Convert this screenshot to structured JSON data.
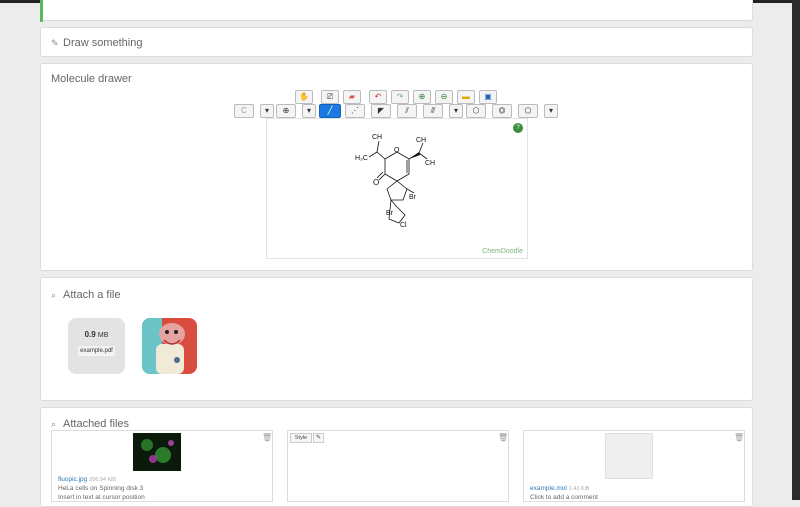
{
  "draw_section": {
    "title": "Draw something"
  },
  "molecule_section": {
    "title": "Molecule drawer",
    "toolbar_row1": [
      "hand-icon",
      "clear-icon",
      "eraser-icon",
      "undo-icon",
      "redo-icon",
      "zoom-in-icon",
      "zoom-out-icon",
      "open-icon",
      "save-icon"
    ],
    "element_label": "C",
    "canvas_badge": "?",
    "watermark": "ChemDoodle",
    "atom_labels": {
      "o": "O",
      "ch3_a": "CH",
      "ch3_b": "CH",
      "ch3_c": "CH",
      "h3c": "H₃C",
      "br1": "Br",
      "br2": "Br",
      "cl": "Cl"
    }
  },
  "attach_section": {
    "title": "Attach a file",
    "pdf_size_value": "0.9",
    "pdf_size_unit": "MB",
    "pdf_name": "example.pdf"
  },
  "attached_files": {
    "title": "Attached files",
    "file1_name": "fluopic.jpg",
    "file1_size": "206.94 KiB",
    "file1_comment": "HeLa cells on Spinning disk 3",
    "file1_action": "Insert in text at cursor position",
    "file2_style": "Style",
    "file3_name": "example.mol",
    "file3_size": "1.43 KiB",
    "file3_comment": "Click to add a comment"
  },
  "colors": {
    "accent_green": "#5cb85c",
    "tool_selected": "#1a7ae0"
  }
}
